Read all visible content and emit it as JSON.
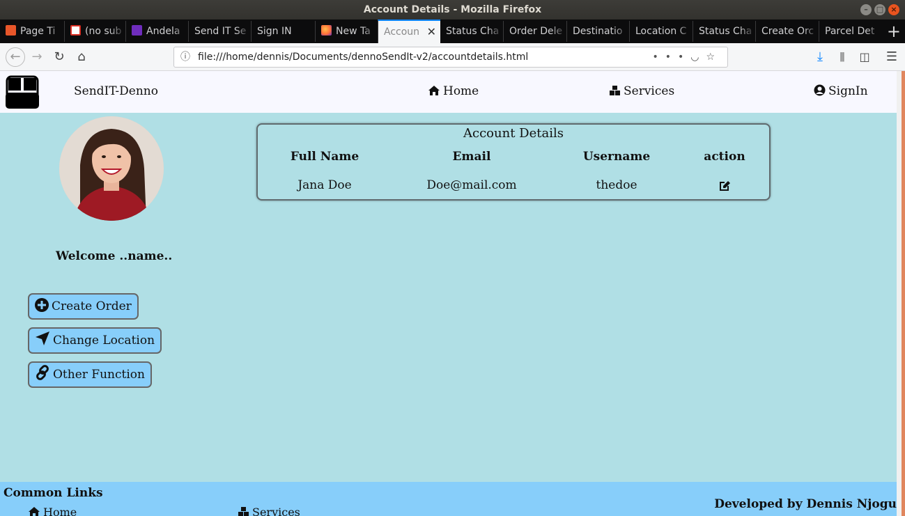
{
  "window": {
    "title": "Account Details - Mozilla Firefox"
  },
  "tabs": [
    {
      "label": "Page Ti",
      "fav": "#e8562a"
    },
    {
      "label": "(no sub",
      "fav": "#d93025"
    },
    {
      "label": "Andela",
      "fav": "#6f2dbd"
    },
    {
      "label": "Send IT Se",
      "fav": ""
    },
    {
      "label": "Sign IN",
      "fav": ""
    },
    {
      "label": "New Ta",
      "fav": "#ff7139"
    },
    {
      "label": "Accoun",
      "fav": ""
    },
    {
      "label": "Status Cha",
      "fav": ""
    },
    {
      "label": "Order Dele",
      "fav": ""
    },
    {
      "label": "Destinatio",
      "fav": ""
    },
    {
      "label": "Location C",
      "fav": ""
    },
    {
      "label": "Status Cha",
      "fav": ""
    },
    {
      "label": "Create Orc",
      "fav": ""
    },
    {
      "label": "Parcel Det",
      "fav": ""
    }
  ],
  "urlbar": {
    "url": "file:///home/dennis/Documents/dennoSendIt-v2/accountdetails.html"
  },
  "header": {
    "brand": "SendIT-Denno",
    "nav": {
      "home": "Home",
      "services": "Services",
      "signin": "SignIn"
    }
  },
  "sidebar": {
    "welcome": "Welcome ..name..",
    "buttons": {
      "create_order": "Create Order",
      "change_location": "Change Location",
      "other_function": "Other Function"
    }
  },
  "account": {
    "title": "Account Details",
    "columns": [
      "Full Name",
      "Email",
      "Username",
      "action"
    ],
    "row": {
      "full_name": "Jana Doe",
      "email": "Doe@mail.com",
      "username": "thedoe"
    }
  },
  "footer": {
    "title": "Common Links",
    "links": {
      "home": "Home",
      "services": "Services"
    },
    "credit": "Developed by Dennis Njogu"
  },
  "colors": {
    "page_bg": "#b0dfe5",
    "button_bg": "#87cefa",
    "footer_bg": "#87cefa",
    "header_bg": "#f8f8ff"
  }
}
